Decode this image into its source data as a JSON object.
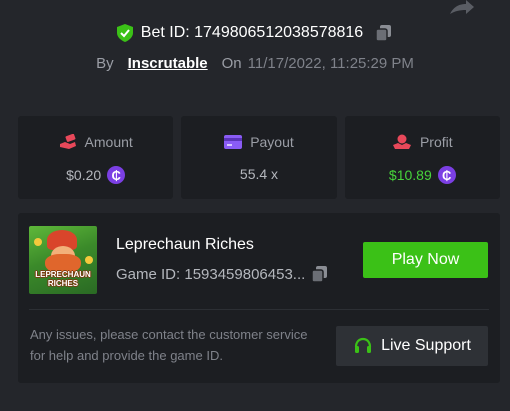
{
  "bet": {
    "id_label": "Bet ID: 1749806512038578816",
    "by_label": "By",
    "user": "Inscrutable",
    "on_label": "On",
    "date": "11/17/2022, 11:25:29 PM"
  },
  "stats": {
    "amount": {
      "label": "Amount",
      "value": "$0.20",
      "icon": "cash-hand-icon"
    },
    "payout": {
      "label": "Payout",
      "value": "55.4 x",
      "icon": "card-icon"
    },
    "profit": {
      "label": "Profit",
      "value": "$10.89",
      "icon": "profit-hand-icon"
    }
  },
  "currency_symbol": "₵",
  "game": {
    "thumbnail_text": "LEPRECHAUN RICHES",
    "name": "Leprechaun Riches",
    "id_label": "Game ID: 1593459806453...",
    "play_label": "Play Now"
  },
  "support": {
    "notice": "Any issues, please contact the customer service for help and provide the game ID.",
    "button_label": "Live Support"
  },
  "colors": {
    "background": "#24262b",
    "card": "#1c1e22",
    "accent_green": "#3bc117",
    "profit_green": "#47d43b",
    "coin_purple": "#7b3fe4",
    "amount_red": "#e8485a",
    "payout_purple": "#8a5cf5"
  }
}
